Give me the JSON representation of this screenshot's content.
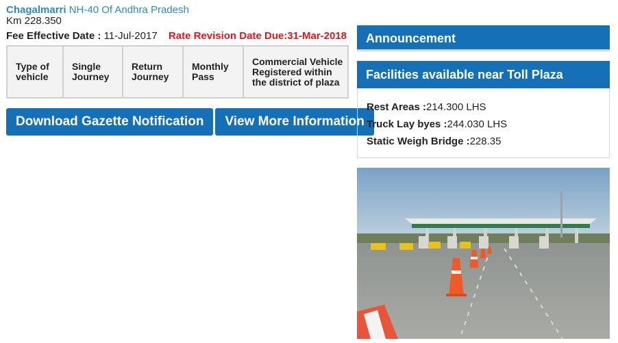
{
  "plaza": {
    "name": "Chagalmarri",
    "highway": "NH-40 Of Andhra Pradesh",
    "km": "Km 228.350"
  },
  "fee": {
    "effective_label": "Fee Effective Date :",
    "effective_value": "11-Jul-2017",
    "revision": "Rate Revision Date Due:31-Mar-2018"
  },
  "table": {
    "headers": [
      "Type of vehicle",
      "Single Journey",
      "Return Journey",
      "Monthly Pass",
      "Commercial Vehicle Registered within the district of plaza"
    ]
  },
  "buttons": {
    "gazette": "Download Gazette Notification",
    "more_info": "View More Information"
  },
  "announcement": {
    "title": "Announcement"
  },
  "facilities": {
    "title": "Facilities available near Toll Plaza",
    "items": [
      {
        "label": "Rest Areas :",
        "value": "214.300 LHS"
      },
      {
        "label": "Truck Lay byes :",
        "value": "244.030 LHS"
      },
      {
        "label": "Static Weigh Bridge :",
        "value": "228.35"
      }
    ]
  },
  "colors": {
    "primary": "#1570b8",
    "link": "#2a8cb8",
    "alert": "#e8141b"
  }
}
